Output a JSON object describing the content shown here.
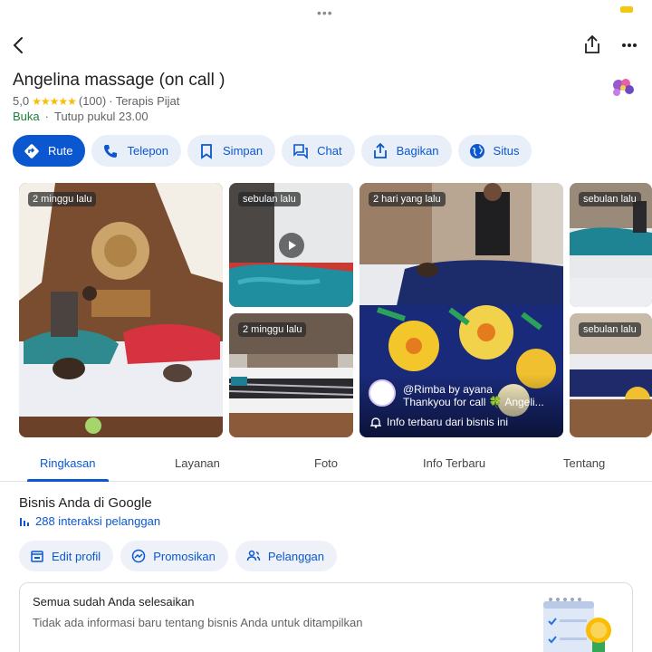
{
  "header": {
    "title": "Angelina massage (on call )",
    "rating": "5,0",
    "stars": "★★★★★",
    "reviews": "(100)",
    "separator": "·",
    "category": "Terapis Pijat",
    "status_open": "Buka",
    "status_dot": "·",
    "status_close": "Tutup pukul 23.00"
  },
  "actions": [
    {
      "label": "Rute",
      "icon": "directions-icon"
    },
    {
      "label": "Telepon",
      "icon": "phone-icon"
    },
    {
      "label": "Simpan",
      "icon": "bookmark-icon"
    },
    {
      "label": "Chat",
      "icon": "chat-icon"
    },
    {
      "label": "Bagikan",
      "icon": "share-icon"
    },
    {
      "label": "Situs",
      "icon": "globe-icon"
    }
  ],
  "photos": {
    "p1_badge": "2 minggu lalu",
    "p2_badge": "sebulan lalu",
    "p3_badge": "2 minggu lalu",
    "p4_badge": "2 hari yang lalu",
    "p4_user": "@Rimba by ayana",
    "p4_text": "Thankyou for call 🍀 Angeli...",
    "p4_info": "Info terbaru dari bisnis ini",
    "p5_badge": "sebulan lalu",
    "p6_badge": "sebulan lalu"
  },
  "tabs": [
    "Ringkasan",
    "Layanan",
    "Foto",
    "Info Terbaru",
    "Tentang"
  ],
  "business": {
    "title": "Bisnis Anda di Google",
    "stat": "288 interaksi pelanggan",
    "actions": [
      "Edit profil",
      "Promosikan",
      "Pelanggan"
    ]
  },
  "card": {
    "title": "Semua sudah Anda selesaikan",
    "subtitle": "Tidak ada informasi baru tentang bisnis Anda untuk ditampilkan"
  },
  "colors": {
    "accent": "#0b57d0",
    "chip_bg": "#e8eff9",
    "star": "#fbbc04",
    "open": "#188038"
  }
}
